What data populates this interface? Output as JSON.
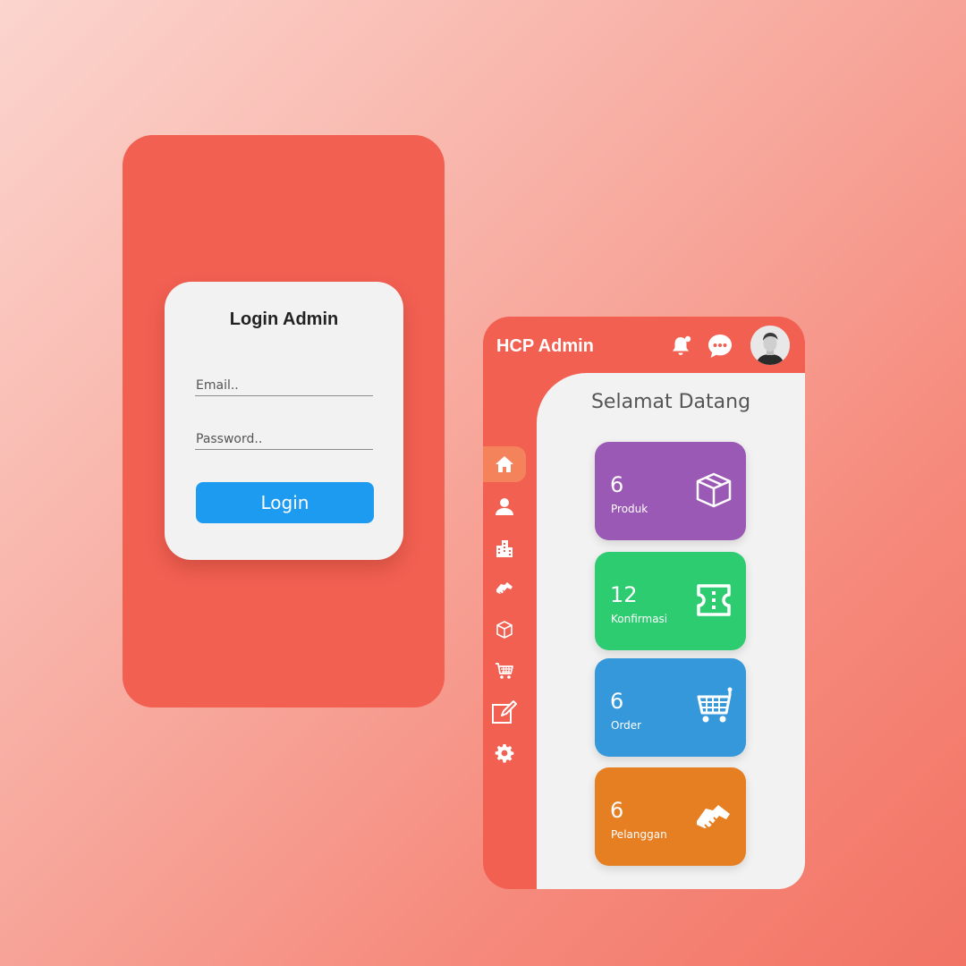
{
  "login": {
    "title": "Login Admin",
    "email_placeholder": "Email..",
    "password_placeholder": "Password..",
    "button_label": "Login"
  },
  "admin": {
    "brand": "HCP Admin",
    "welcome": "Selamat Datang",
    "nav": [
      "home-icon",
      "user-icon",
      "building-icon",
      "handshake-icon",
      "box-icon",
      "cart-icon",
      "edit-icon",
      "gear-icon"
    ],
    "cards": [
      {
        "count": "6",
        "label": "Produk",
        "color": "#9b59b6",
        "icon": "box-icon"
      },
      {
        "count": "12",
        "label": "Konfirmasi",
        "color": "#2ecc71",
        "icon": "ticket-icon"
      },
      {
        "count": "6",
        "label": "Order",
        "color": "#3498db",
        "icon": "cart-icon"
      },
      {
        "count": "6",
        "label": "Pelanggan",
        "color": "#e67e22",
        "icon": "handshake-icon"
      }
    ]
  },
  "colors": {
    "phone_bg": "#f26052",
    "card_bg": "#f2f2f2",
    "login_button": "#1d9bf0",
    "nav_active": "#f4835b"
  }
}
